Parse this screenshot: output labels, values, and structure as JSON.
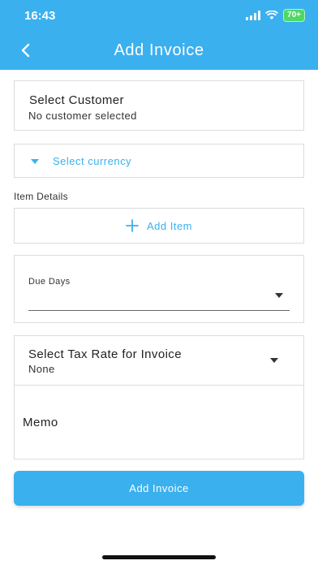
{
  "status_bar": {
    "time": "16:43",
    "battery": "70+"
  },
  "header": {
    "title": "Add Invoice"
  },
  "customer": {
    "title": "Select Customer",
    "subtitle": "No customer selected"
  },
  "currency": {
    "label": "Select currency"
  },
  "items": {
    "section_label": "Item Details",
    "add_label": "Add Item"
  },
  "due_days": {
    "label": "Due Days"
  },
  "tax": {
    "title": "Select Tax Rate for Invoice",
    "value": "None"
  },
  "memo": {
    "label": "Memo"
  },
  "submit": {
    "label": "Add Invoice"
  },
  "colors": {
    "accent": "#3ab0ef",
    "battery": "#4cd964"
  }
}
